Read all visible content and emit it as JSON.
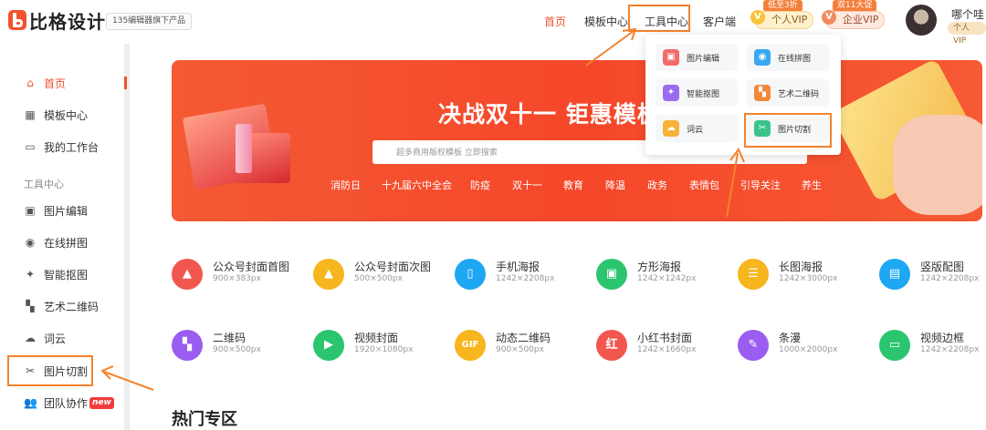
{
  "header": {
    "logo_letter": "b",
    "logo_text": "比格设计",
    "tagline": "135编辑器旗下产品",
    "nav": {
      "home": "首页",
      "templates": "模板中心",
      "tools": "工具中心",
      "client": "客户端"
    },
    "personal_vip": {
      "badge": "低至3折",
      "label": "个人VIP"
    },
    "enterprise_vip": {
      "badge": "双11大促",
      "label": "企业VIP"
    },
    "user": {
      "name": "哪个哇",
      "tag": "个人VIP"
    }
  },
  "sidebar": {
    "items": [
      {
        "label": "首页",
        "icon": "home-icon"
      },
      {
        "label": "模板中心",
        "icon": "grid-icon"
      },
      {
        "label": "我的工作台",
        "icon": "monitor-icon"
      }
    ],
    "group_title": "工具中心",
    "tool_items": [
      {
        "label": "图片编辑",
        "icon": "image-edit-icon"
      },
      {
        "label": "在线拼图",
        "icon": "puzzle-icon"
      },
      {
        "label": "智能抠图",
        "icon": "magic-wand-icon"
      },
      {
        "label": "艺术二维码",
        "icon": "qrcode-icon"
      },
      {
        "label": "词云",
        "icon": "cloud-icon"
      },
      {
        "label": "图片切割",
        "icon": "scissors-icon"
      },
      {
        "label": "团队协作",
        "icon": "team-icon",
        "badge": "new"
      }
    ]
  },
  "banner": {
    "title": "决战双十一 钜惠模板",
    "search_placeholder": "超多商用版权模板 立即搜索",
    "tags": [
      "消防日",
      "十九届六中全会",
      "防疫",
      "双十一",
      "教育",
      "降温",
      "政务",
      "表情包",
      "引导关注",
      "养生"
    ]
  },
  "dropdown": {
    "items": [
      {
        "label": "图片编辑",
        "icon": "image-edit-icon",
        "color": "#f26b6b"
      },
      {
        "label": "在线拼图",
        "icon": "puzzle-icon",
        "color": "#3aa8f2"
      },
      {
        "label": "智能抠图",
        "icon": "magic-wand-icon",
        "color": "#9b6cf0"
      },
      {
        "label": "艺术二维码",
        "icon": "qrcode-icon",
        "color": "#f2883a"
      },
      {
        "label": "词云",
        "icon": "cloud-icon",
        "color": "#f5b33a"
      },
      {
        "label": "图片切割",
        "icon": "scissors-icon",
        "color": "#3ac48c"
      }
    ]
  },
  "tools": [
    {
      "name": "公众号封面首图",
      "size": "900×383px",
      "color": "#f2574f",
      "icon": "cover-icon"
    },
    {
      "name": "公众号封面次图",
      "size": "500×500px",
      "color": "#f7b51e",
      "icon": "cover-secondary-icon"
    },
    {
      "name": "手机海报",
      "size": "1242×2208px",
      "color": "#1ea7f2",
      "icon": "phone-icon"
    },
    {
      "name": "方形海报",
      "size": "1242×1242px",
      "color": "#2cc56f",
      "icon": "image-icon"
    },
    {
      "name": "长图海报",
      "size": "1242×3000px",
      "color": "#f7b51e",
      "icon": "long-image-icon"
    },
    {
      "name": "竖版配图",
      "size": "1242×2208px",
      "color": "#1ea7f2",
      "icon": "vertical-image-icon"
    },
    {
      "name": "二维码",
      "size": "900×500px",
      "color": "#9b5cf0",
      "icon": "qrcode-icon"
    },
    {
      "name": "视频封面",
      "size": "1920×1080px",
      "color": "#2cc56f",
      "icon": "video-icon"
    },
    {
      "name": "动态二维码",
      "size": "900×500px",
      "color": "#f7b51e",
      "icon": "gif-icon",
      "glyph": "GIF"
    },
    {
      "name": "小红书封面",
      "size": "1242×1660px",
      "color": "#f2574f",
      "icon": "xiaohongshu-icon"
    },
    {
      "name": "条漫",
      "size": "1000×2000px",
      "color": "#9b5cf0",
      "icon": "palette-icon"
    },
    {
      "name": "视频边框",
      "size": "1242×2208px",
      "color": "#2cc56f",
      "icon": "frame-icon"
    }
  ],
  "hot_title": "热门专区",
  "colors": {
    "brand": "#f0532e",
    "highlight_box": "#f4822c"
  }
}
